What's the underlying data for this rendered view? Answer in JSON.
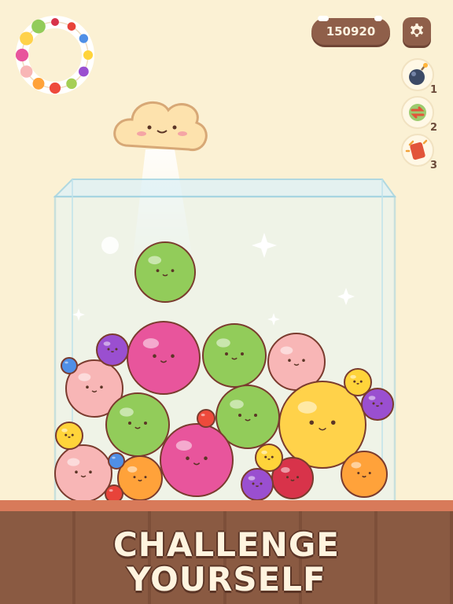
{
  "hud": {
    "score": "150920",
    "settings_icon": "gear-icon"
  },
  "powerups": [
    {
      "icon": "bomb-icon",
      "count": "1"
    },
    {
      "icon": "swap-icon",
      "count": "2"
    },
    {
      "icon": "shake-icon",
      "count": "3"
    }
  ],
  "fruit_cycle": [
    "cherry",
    "strawberry",
    "blueberry",
    "lemon",
    "mangosteen",
    "kiwi",
    "tomato",
    "orange",
    "peach",
    "dragonfruit",
    "melon",
    "watermelon"
  ],
  "slogan": {
    "line1": "CHALLENGE",
    "line2": "YOURSELF"
  },
  "colors": {
    "background": "#fbf1d4",
    "hud_brown": "#8f5f4a",
    "floor": "#8a5a42",
    "floor_top": "#d87a5a"
  }
}
